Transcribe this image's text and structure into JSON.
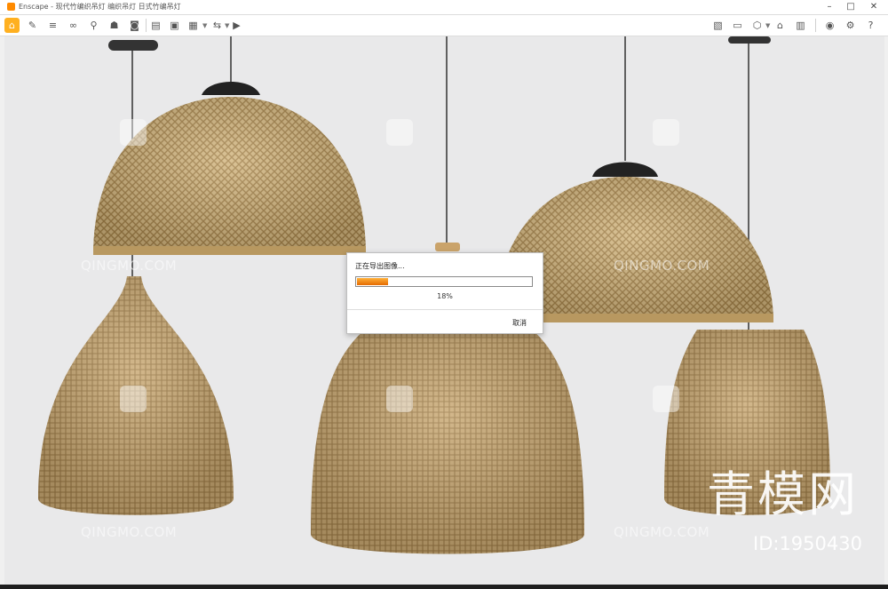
{
  "window": {
    "title": "Enscape - 现代竹编织吊灯 编织吊灯 日式竹编吊灯",
    "minimize_glyph": "–",
    "maximize_glyph": "□",
    "close_glyph": "✕"
  },
  "toolbar": {
    "left_icons": [
      "home-icon",
      "brush-icon",
      "layers-icon",
      "binoculars-icon",
      "pin-icon",
      "lamp-icon",
      "camera-icon",
      "palette-icon",
      "export-image-icon",
      "export-batch-icon",
      "export-panorama-icon",
      "export-video-icon"
    ],
    "right_icons": [
      "map-icon",
      "window-icon",
      "cube-icon",
      "building-icon",
      "settings-icon",
      "eye-icon",
      "gear-icon",
      "help-icon"
    ],
    "glyphs": {
      "home": "⌂",
      "brush": "✎",
      "layers": "≡",
      "binoculars": "∞",
      "pin": "⚲",
      "lamp": "☗",
      "camera": "◙",
      "palette": "▤",
      "export_image": "▣",
      "export_batch": "▦",
      "export_panorama": "⇆",
      "export_video": "▶",
      "map": "▧",
      "window": "▭",
      "cube": "⬡",
      "building": "⌂",
      "settings": "▥",
      "eye": "◉",
      "gear": "⚙",
      "help": "?"
    }
  },
  "dialog": {
    "message": "正在导出图像...",
    "progress": 0.18,
    "percent_text": "18%",
    "cancel_label": "取消",
    "accent_color": "#f07a00"
  },
  "watermark": {
    "brand": "青模网",
    "id_text": "ID:1950430",
    "repeat_text": "QINGMO.COM"
  }
}
